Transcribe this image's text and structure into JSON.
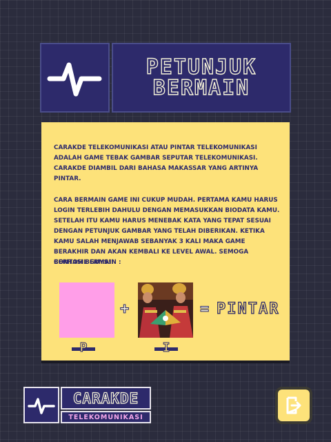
{
  "header": {
    "icon": "pulse-icon",
    "title": "PETUNJUK BERMAIN",
    "title_line1": "PETUNJUK",
    "title_line2": "BERMAIN"
  },
  "instructions": {
    "paragraph1": "CARAKDE TELEKOMUNIKASI ATAU PINTAR TELEKOMUNIKASI ADALAH GAME TEBAK GAMBAR SEPUTAR TELEKOMUNIKASI. CARAKDE DIAMBIL DARI BAHASA MAKASSAR YANG ARTINYA PINTAR.",
    "paragraph2": "CARA BERMAIN GAME INI CUKUP MUDAH. PERTAMA KAMU HARUS LOGIN TERLEBIH DAHULU DENGAN MEMASUKKAN BIODATA KAMU. SETELAH ITU KAMU HARUS MENEBAK KATA YANG TEPAT SESUAI DENGAN PETUNJUK GAMBAR YANG TELAH DIBERIKAN. KETIKA KAMU SALAH MENJAWAB SEBANYAK 3 KALI MAKA GAME BERAKHIR DAN AKAN KEMBALI KE LEVEL AWAL. SEMOGA BERHASIL GUYS!!",
    "example_label": "CONTOH BERMAIN :"
  },
  "example": {
    "tile1_color": "#ff9ee8",
    "plus": "+",
    "equals": "=",
    "answer": "PINTAR",
    "letter1": "P",
    "letter2": "I"
  },
  "logo": {
    "icon": "pulse-icon",
    "main": "CARAKDE",
    "sub": "TELEKOMUNIKASI"
  },
  "exit_button": {
    "icon": "exit-icon"
  },
  "colors": {
    "navy": "#2d2a6b",
    "yellow": "#fde27a",
    "pink": "#ff9ee8",
    "background": "#2b2c3d"
  }
}
